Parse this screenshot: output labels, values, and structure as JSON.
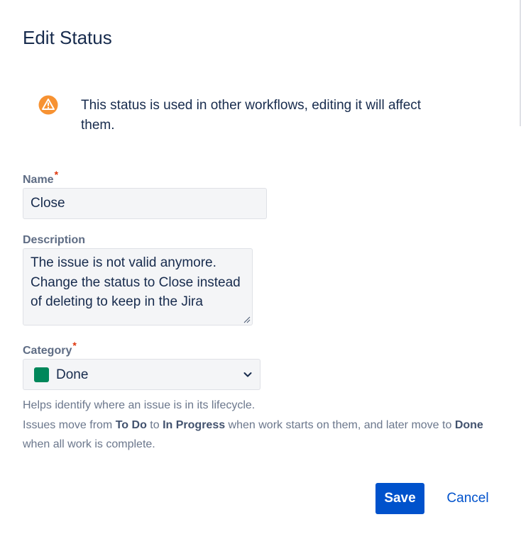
{
  "dialog": {
    "title": "Edit Status",
    "warning": {
      "icon": "warning-icon",
      "text": "This status is used in other workflows, editing it will affect them.",
      "color": "#f79232"
    },
    "name": {
      "label": "Name",
      "required_mark": "*",
      "value": "Close"
    },
    "description": {
      "label": "Description",
      "value": "The issue is not valid anymore. Change the status to Close instead of deleting to keep in the Jira"
    },
    "category": {
      "label": "Category",
      "required_mark": "*",
      "selected": "Done",
      "swatch_color": "#00875a",
      "icon": "chevron-down-icon"
    },
    "help": {
      "line1": "Helps identify where an issue is in its lifecycle.",
      "line2_prefix": "Issues move from ",
      "todo": "To Do",
      "to": " to ",
      "in_progress": "In Progress",
      "line2_middle": " when work starts on them, and later move to ",
      "done": "Done",
      "line3": "when all work is complete."
    },
    "buttons": {
      "save": "Save",
      "cancel": "Cancel"
    }
  }
}
